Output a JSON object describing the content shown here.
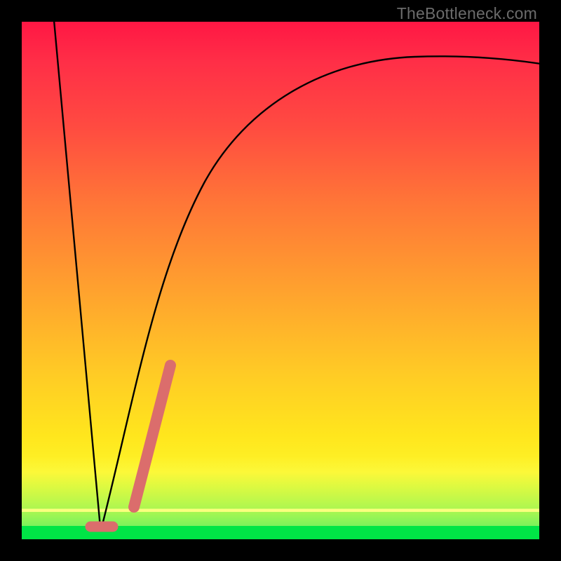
{
  "watermark": "TheBottleneck.com",
  "colors": {
    "frame": "#000000",
    "gradient_top": "#ff1744",
    "gradient_mid": "#ffcb25",
    "gradient_bottom": "#f6ff4e",
    "green_band": "#00e546",
    "curve": "#000000",
    "marker": "#db6d6c"
  },
  "chart_data": {
    "type": "line",
    "title": "",
    "xlabel": "",
    "ylabel": "",
    "xlim": [
      0,
      100
    ],
    "ylim": [
      0,
      100
    ],
    "grid": false,
    "legend": false,
    "series": [
      {
        "name": "bottleneck-curve",
        "x": [
          6,
          8,
          10,
          12,
          14,
          15.2,
          16,
          18,
          20,
          24,
          28,
          35,
          45,
          55,
          65,
          75,
          85,
          95,
          100
        ],
        "values": [
          100,
          89,
          77,
          55,
          30,
          2,
          6,
          22,
          35,
          52,
          64,
          75,
          84,
          89,
          92,
          93,
          93,
          92,
          92
        ]
      }
    ],
    "annotations": [
      {
        "name": "highlight-min",
        "type": "segment",
        "color": "#db6d6c",
        "x": [
          13.3,
          17.6
        ],
        "y": [
          2.4,
          2.4
        ]
      },
      {
        "name": "highlight-slope",
        "type": "segment",
        "color": "#db6d6c",
        "x": [
          21.7,
          28.7
        ],
        "y": [
          6.2,
          33.6
        ]
      }
    ],
    "background_gradient": {
      "direction": "vertical",
      "stops": [
        {
          "pos": 0.0,
          "color": "#ff1744"
        },
        {
          "pos": 0.35,
          "color": "#ff7637"
        },
        {
          "pos": 0.68,
          "color": "#ffcb25"
        },
        {
          "pos": 0.9,
          "color": "#fdfb2f"
        },
        {
          "pos": 0.975,
          "color": "#00e546"
        }
      ]
    }
  }
}
